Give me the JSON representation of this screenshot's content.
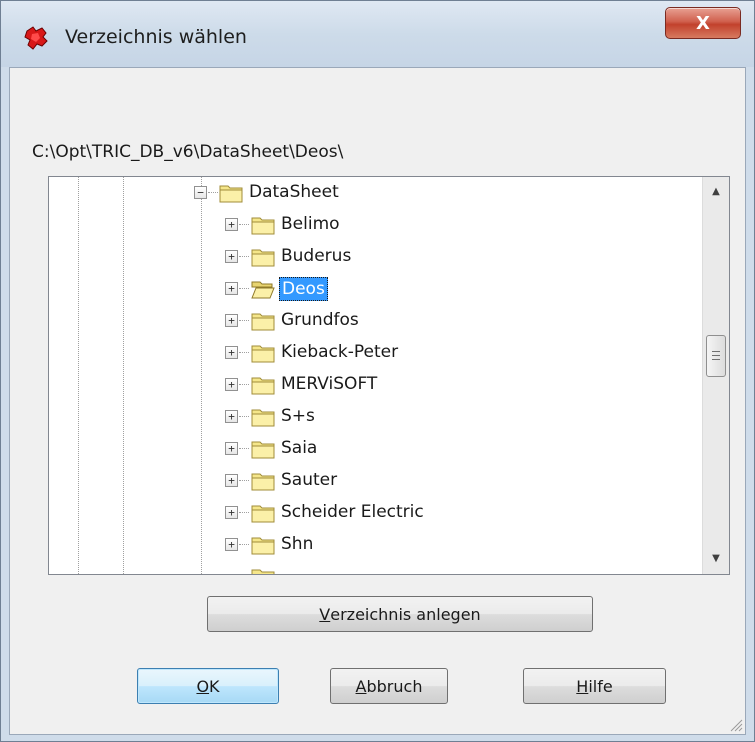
{
  "window": {
    "title": "Verzeichnis wählen",
    "close_label": "X"
  },
  "path_label": "C:\\Opt\\TRIC_DB_v6\\DataSheet\\Deos\\",
  "tree": {
    "parent": "DataSheet",
    "children": [
      {
        "label": "Belimo",
        "selected": false
      },
      {
        "label": "Buderus",
        "selected": false
      },
      {
        "label": "Deos",
        "selected": true
      },
      {
        "label": "Grundfos",
        "selected": false
      },
      {
        "label": "Kieback-Peter",
        "selected": false
      },
      {
        "label": "MERViSOFT",
        "selected": false
      },
      {
        "label": "S+s",
        "selected": false
      },
      {
        "label": "Saia",
        "selected": false
      },
      {
        "label": "Sauter",
        "selected": false
      },
      {
        "label": "Scheider Electric",
        "selected": false
      },
      {
        "label": "Shn",
        "selected": false
      }
    ]
  },
  "buttons": {
    "create_dir": {
      "mnemonic": "V",
      "rest": "erzeichnis anlegen"
    },
    "ok": {
      "mnemonic": "O",
      "rest": "K"
    },
    "cancel": {
      "mnemonic": "A",
      "rest": "bbruch"
    },
    "help": {
      "mnemonic": "H",
      "rest": "ilfe"
    }
  },
  "colors": {
    "selection": "#3399ff",
    "titlebar": "#cddbe9",
    "close_button": "#c2412c",
    "folder": "#f5e68a"
  }
}
